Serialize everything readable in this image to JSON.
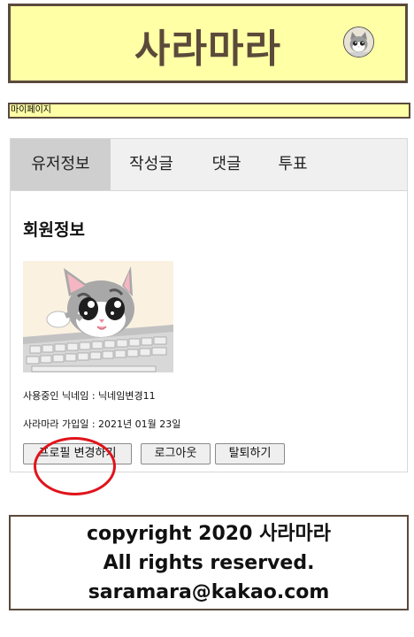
{
  "header": {
    "site_title": "사라마라"
  },
  "nav": {
    "mypage_label": "마이페이지"
  },
  "tabs": [
    {
      "label": "유저정보",
      "active": true
    },
    {
      "label": "작성글",
      "active": false
    },
    {
      "label": "댓글",
      "active": false
    },
    {
      "label": "투표",
      "active": false
    }
  ],
  "profile": {
    "section_title": "회원정보",
    "nickname_line": "사용중인 닉네임 : 닉네임변경11",
    "joined_line": "사라마라 가입일 : 2021년 01월 23일"
  },
  "buttons": {
    "edit_profile": "프로필 변경하기",
    "logout": "로그아웃",
    "withdraw": "탈퇴하기"
  },
  "footer": {
    "copyright": "copyright 2020 사라마라",
    "rights": "All rights reserved.",
    "email": "saramara@kakao.com"
  },
  "colors": {
    "header_bg": "#ffffa6",
    "border": "#5a4a3c",
    "title_color": "#5b4a3a",
    "annotation_red": "#e0141b"
  }
}
